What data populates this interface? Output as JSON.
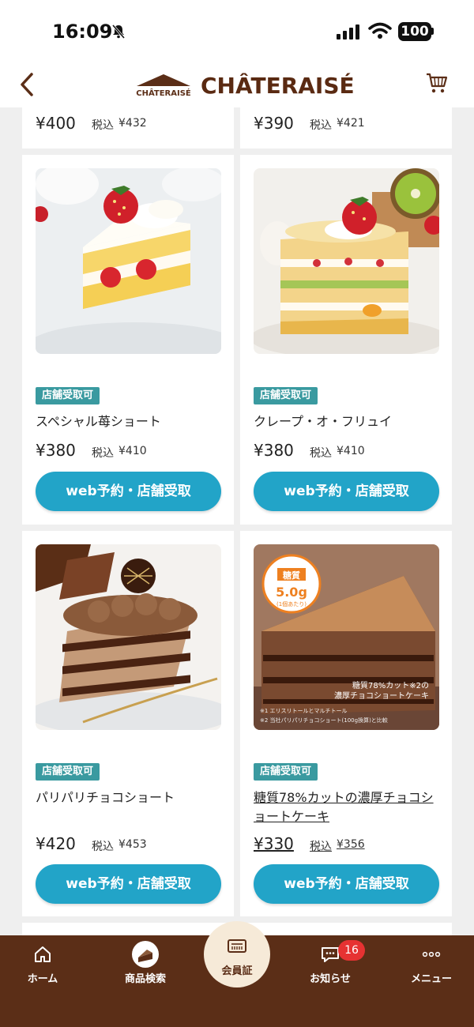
{
  "status_bar": {
    "time": "16:09",
    "battery": "100"
  },
  "header": {
    "logo_small": "CHÂTERAISÉ",
    "logo_text": "CHÂTERAISÉ"
  },
  "top_row": [
    {
      "price": "¥400",
      "tax_label": "税込",
      "tax_price": "¥432"
    },
    {
      "price": "¥390",
      "tax_label": "税込",
      "tax_price": "¥421"
    }
  ],
  "products": [
    {
      "badge": "店舗受取可",
      "name": "スペシャル苺ショート",
      "price": "¥380",
      "tax_label": "税込",
      "tax_price": "¥410",
      "cta": "web予約・店舗受取"
    },
    {
      "badge": "店舗受取可",
      "name": "クレープ・オ・フリュイ",
      "price": "¥380",
      "tax_label": "税込",
      "tax_price": "¥410",
      "cta": "web予約・店舗受取"
    },
    {
      "badge": "店舗受取可",
      "name": "パリパリチョコショート",
      "price": "¥420",
      "tax_label": "税込",
      "tax_price": "¥453",
      "cta": "web予約・店舗受取"
    },
    {
      "badge": "店舗受取可",
      "name": "糖質78%カットの濃厚チョコショートケーキ",
      "price": "¥330",
      "tax_label": "税込",
      "tax_price": "¥356",
      "cta": "web予約・店舗受取",
      "image_text": {
        "seal_top": "糖質",
        "seal_value": "5.0g",
        "seal_note": "(1個あたり)",
        "caption1": "糖質78%カット※2の",
        "caption2": "濃厚チョコショートケーキ",
        "foot1": "※1 エリスリトールとマルチトール",
        "foot2": "※2 当社パリパリチョコショート(100g換算)と比較"
      }
    }
  ],
  "tabbar": {
    "home": "ホーム",
    "search": "商品検索",
    "member": "会員証",
    "news": "お知らせ",
    "news_count": "16",
    "menu": "メニュー"
  },
  "colors": {
    "brand_brown": "#5b2e17",
    "cta_blue": "#22a4c8",
    "badge_teal": "#3a9aa0",
    "notif_red": "#e63232"
  }
}
